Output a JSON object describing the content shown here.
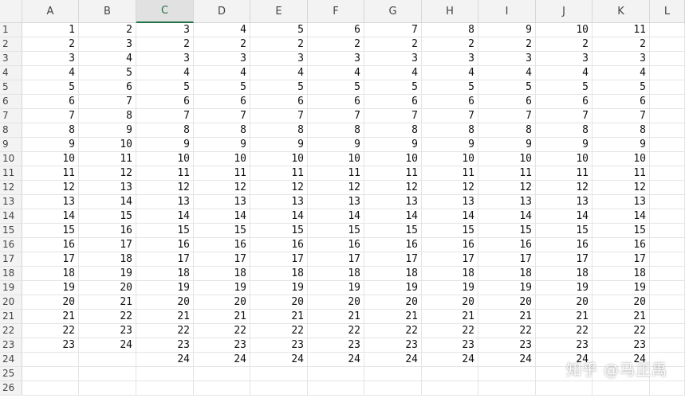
{
  "columns": [
    "A",
    "B",
    "C",
    "D",
    "E",
    "F",
    "G",
    "H",
    "I",
    "J",
    "K",
    "L"
  ],
  "selected_column": "C",
  "row_numbers": [
    "1",
    "2",
    "3",
    "4",
    "5",
    "6",
    "7",
    "8",
    "9",
    "10",
    "11",
    "12",
    "13",
    "14",
    "15",
    "16",
    "17",
    "18",
    "19",
    "20",
    "21",
    "22",
    "23",
    "24",
    "25",
    "26"
  ],
  "rows": [
    [
      "1",
      "2",
      "3",
      "4",
      "5",
      "6",
      "7",
      "8",
      "9",
      "10",
      "11",
      ""
    ],
    [
      "2",
      "3",
      "2",
      "2",
      "2",
      "2",
      "2",
      "2",
      "2",
      "2",
      "2",
      ""
    ],
    [
      "3",
      "4",
      "3",
      "3",
      "3",
      "3",
      "3",
      "3",
      "3",
      "3",
      "3",
      ""
    ],
    [
      "4",
      "5",
      "4",
      "4",
      "4",
      "4",
      "4",
      "4",
      "4",
      "4",
      "4",
      ""
    ],
    [
      "5",
      "6",
      "5",
      "5",
      "5",
      "5",
      "5",
      "5",
      "5",
      "5",
      "5",
      ""
    ],
    [
      "6",
      "7",
      "6",
      "6",
      "6",
      "6",
      "6",
      "6",
      "6",
      "6",
      "6",
      ""
    ],
    [
      "7",
      "8",
      "7",
      "7",
      "7",
      "7",
      "7",
      "7",
      "7",
      "7",
      "7",
      ""
    ],
    [
      "8",
      "9",
      "8",
      "8",
      "8",
      "8",
      "8",
      "8",
      "8",
      "8",
      "8",
      ""
    ],
    [
      "9",
      "10",
      "9",
      "9",
      "9",
      "9",
      "9",
      "9",
      "9",
      "9",
      "9",
      ""
    ],
    [
      "10",
      "11",
      "10",
      "10",
      "10",
      "10",
      "10",
      "10",
      "10",
      "10",
      "10",
      ""
    ],
    [
      "11",
      "12",
      "11",
      "11",
      "11",
      "11",
      "11",
      "11",
      "11",
      "11",
      "11",
      ""
    ],
    [
      "12",
      "13",
      "12",
      "12",
      "12",
      "12",
      "12",
      "12",
      "12",
      "12",
      "12",
      ""
    ],
    [
      "13",
      "14",
      "13",
      "13",
      "13",
      "13",
      "13",
      "13",
      "13",
      "13",
      "13",
      ""
    ],
    [
      "14",
      "15",
      "14",
      "14",
      "14",
      "14",
      "14",
      "14",
      "14",
      "14",
      "14",
      ""
    ],
    [
      "15",
      "16",
      "15",
      "15",
      "15",
      "15",
      "15",
      "15",
      "15",
      "15",
      "15",
      ""
    ],
    [
      "16",
      "17",
      "16",
      "16",
      "16",
      "16",
      "16",
      "16",
      "16",
      "16",
      "16",
      ""
    ],
    [
      "17",
      "18",
      "17",
      "17",
      "17",
      "17",
      "17",
      "17",
      "17",
      "17",
      "17",
      ""
    ],
    [
      "18",
      "19",
      "18",
      "18",
      "18",
      "18",
      "18",
      "18",
      "18",
      "18",
      "18",
      ""
    ],
    [
      "19",
      "20",
      "19",
      "19",
      "19",
      "19",
      "19",
      "19",
      "19",
      "19",
      "19",
      ""
    ],
    [
      "20",
      "21",
      "20",
      "20",
      "20",
      "20",
      "20",
      "20",
      "20",
      "20",
      "20",
      ""
    ],
    [
      "21",
      "22",
      "21",
      "21",
      "21",
      "21",
      "21",
      "21",
      "21",
      "21",
      "21",
      ""
    ],
    [
      "22",
      "23",
      "22",
      "22",
      "22",
      "22",
      "22",
      "22",
      "22",
      "22",
      "22",
      ""
    ],
    [
      "23",
      "24",
      "23",
      "23",
      "23",
      "23",
      "23",
      "23",
      "23",
      "23",
      "23",
      ""
    ],
    [
      "",
      "",
      "24",
      "24",
      "24",
      "24",
      "24",
      "24",
      "24",
      "24",
      "24",
      ""
    ],
    [
      "",
      "",
      "",
      "",
      "",
      "",
      "",
      "",
      "",
      "",
      "",
      ""
    ],
    [
      "",
      "",
      "",
      "",
      "",
      "",
      "",
      "",
      "",
      "",
      "",
      ""
    ]
  ],
  "watermark": "知乎 @马正禹"
}
